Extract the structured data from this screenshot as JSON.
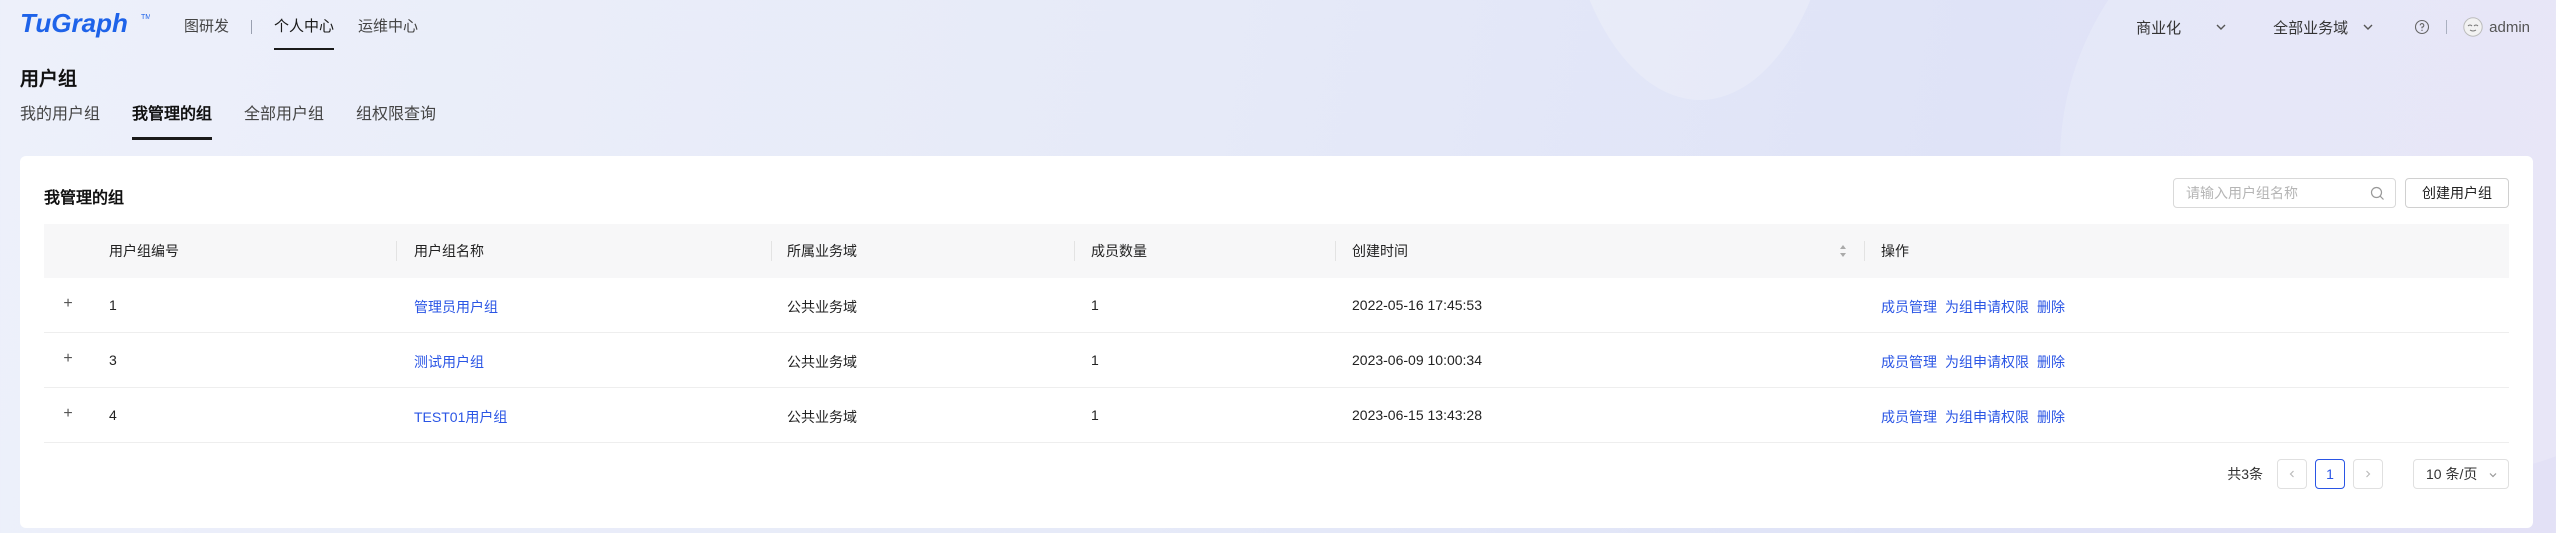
{
  "app": {
    "logo_text": "TuGraph",
    "nav": {
      "items": [
        "图研发",
        "个人中心",
        "运维中心"
      ],
      "active_index": 1
    },
    "right": {
      "mode_label": "商业化",
      "domain_label": "全部业务域",
      "user_name": "admin"
    },
    "accent_color": "#2a55e5"
  },
  "page": {
    "title": "用户组",
    "tabs": [
      "我的用户组",
      "我管理的组",
      "全部用户组",
      "组权限查询"
    ],
    "active_tab": 1
  },
  "card": {
    "title": "我管理的组",
    "search_placeholder": "请输入用户组名称",
    "create_button": "创建用户组"
  },
  "table": {
    "columns": [
      "用户组编号",
      "用户组名称",
      "所属业务域",
      "成员数量",
      "创建时间",
      "操作"
    ],
    "rows": [
      {
        "id": "1",
        "name": "管理员用户组",
        "domain": "公共业务域",
        "members": "1",
        "created": "2022-05-16 17:45:53"
      },
      {
        "id": "3",
        "name": "测试用户组",
        "domain": "公共业务域",
        "members": "1",
        "created": "2023-06-09 10:00:34"
      },
      {
        "id": "4",
        "name": "TEST01用户组",
        "domain": "公共业务域",
        "members": "1",
        "created": "2023-06-15 13:43:28"
      }
    ],
    "actions": [
      "成员管理",
      "为组申请权限",
      "删除"
    ],
    "expand_symbol": "+"
  },
  "pagination": {
    "total": "共3条",
    "current_page": "1",
    "page_size": "10 条/页"
  }
}
